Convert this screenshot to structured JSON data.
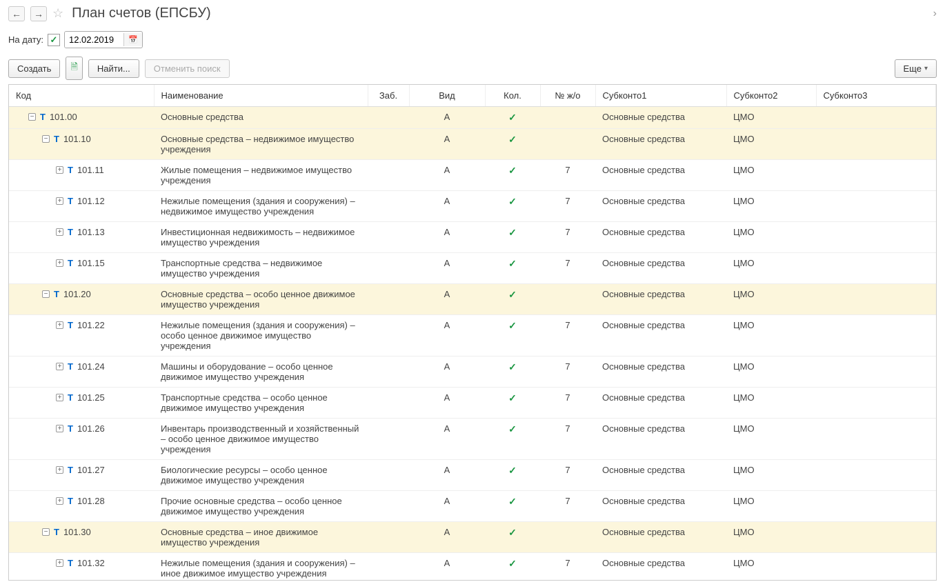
{
  "title": "План счетов (ЕПСБУ)",
  "filter": {
    "label": "На дату:",
    "date": "12.02.2019"
  },
  "toolbar": {
    "create": "Создать",
    "find": "Найти...",
    "cancel_find": "Отменить поиск",
    "more": "Еще"
  },
  "columns": {
    "code": "Код",
    "name": "Наименование",
    "zab": "Заб.",
    "vid": "Вид",
    "kol": "Кол.",
    "jo": "№ ж/о",
    "sub1": "Субконто1",
    "sub2": "Субконто2",
    "sub3": "Субконто3"
  },
  "rows": [
    {
      "indent": 0,
      "toggle": "−",
      "code": "101.00",
      "name": "Основные средства",
      "vid": "А",
      "kol": true,
      "jo": "",
      "sub1": "Основные средства",
      "sub2": "ЦМО",
      "hl": true
    },
    {
      "indent": 1,
      "toggle": "−",
      "code": "101.10",
      "name": "Основные средства – недвижимое имущество учреждения",
      "vid": "А",
      "kol": true,
      "jo": "",
      "sub1": "Основные средства",
      "sub2": "ЦМО",
      "hl": true
    },
    {
      "indent": 2,
      "toggle": "+",
      "code": "101.11",
      "name": "Жилые помещения – недвижимое имущество учреждения",
      "vid": "А",
      "kol": true,
      "jo": "7",
      "sub1": "Основные средства",
      "sub2": "ЦМО",
      "hl": false
    },
    {
      "indent": 2,
      "toggle": "+",
      "code": "101.12",
      "name": "Нежилые помещения (здания и сооружения) – недвижимое имущество учреждения",
      "vid": "А",
      "kol": true,
      "jo": "7",
      "sub1": "Основные средства",
      "sub2": "ЦМО",
      "hl": false
    },
    {
      "indent": 2,
      "toggle": "+",
      "code": "101.13",
      "name": "Инвестиционная недвижимость – недвижимое имущество учреждения",
      "vid": "А",
      "kol": true,
      "jo": "7",
      "sub1": "Основные средства",
      "sub2": "ЦМО",
      "hl": false
    },
    {
      "indent": 2,
      "toggle": "+",
      "code": "101.15",
      "name": "Транспортные средства – недвижимое имущество учреждения",
      "vid": "А",
      "kol": true,
      "jo": "7",
      "sub1": "Основные средства",
      "sub2": "ЦМО",
      "hl": false
    },
    {
      "indent": 1,
      "toggle": "−",
      "code": "101.20",
      "name": "Основные средства – особо ценное движимое имущество учреждения",
      "vid": "А",
      "kol": true,
      "jo": "",
      "sub1": "Основные средства",
      "sub2": "ЦМО",
      "hl": true
    },
    {
      "indent": 2,
      "toggle": "+",
      "code": "101.22",
      "name": "Нежилые помещения (здания и сооружения) – особо ценное движимое имущество учреждения",
      "vid": "А",
      "kol": true,
      "jo": "7",
      "sub1": "Основные средства",
      "sub2": "ЦМО",
      "hl": false
    },
    {
      "indent": 2,
      "toggle": "+",
      "code": "101.24",
      "name": "Машины и оборудование – особо ценное движимое имущество учреждения",
      "vid": "А",
      "kol": true,
      "jo": "7",
      "sub1": "Основные средства",
      "sub2": "ЦМО",
      "hl": false
    },
    {
      "indent": 2,
      "toggle": "+",
      "code": "101.25",
      "name": "Транспортные средства – особо ценное движимое имущество учреждения",
      "vid": "А",
      "kol": true,
      "jo": "7",
      "sub1": "Основные средства",
      "sub2": "ЦМО",
      "hl": false
    },
    {
      "indent": 2,
      "toggle": "+",
      "code": "101.26",
      "name": "Инвентарь производственный и хозяйственный – особо ценное движимое имущество учреждения",
      "vid": "А",
      "kol": true,
      "jo": "7",
      "sub1": "Основные средства",
      "sub2": "ЦМО",
      "hl": false
    },
    {
      "indent": 2,
      "toggle": "+",
      "code": "101.27",
      "name": "Биологические ресурсы – особо ценное движимое имущество учреждения",
      "vid": "А",
      "kol": true,
      "jo": "7",
      "sub1": "Основные средства",
      "sub2": "ЦМО",
      "hl": false
    },
    {
      "indent": 2,
      "toggle": "+",
      "code": "101.28",
      "name": "Прочие основные средства – особо ценное движимое имущество учреждения",
      "vid": "А",
      "kol": true,
      "jo": "7",
      "sub1": "Основные средства",
      "sub2": "ЦМО",
      "hl": false
    },
    {
      "indent": 1,
      "toggle": "−",
      "code": "101.30",
      "name": "Основные средства –  иное движимое имущество учреждения",
      "vid": "А",
      "kol": true,
      "jo": "",
      "sub1": "Основные средства",
      "sub2": "ЦМО",
      "hl": true
    },
    {
      "indent": 2,
      "toggle": "+",
      "code": "101.32",
      "name": "Нежилые помещения (здания и сооружения) – иное движимое имущество учреждения",
      "vid": "А",
      "kol": true,
      "jo": "7",
      "sub1": "Основные средства",
      "sub2": "ЦМО",
      "hl": false
    }
  ]
}
